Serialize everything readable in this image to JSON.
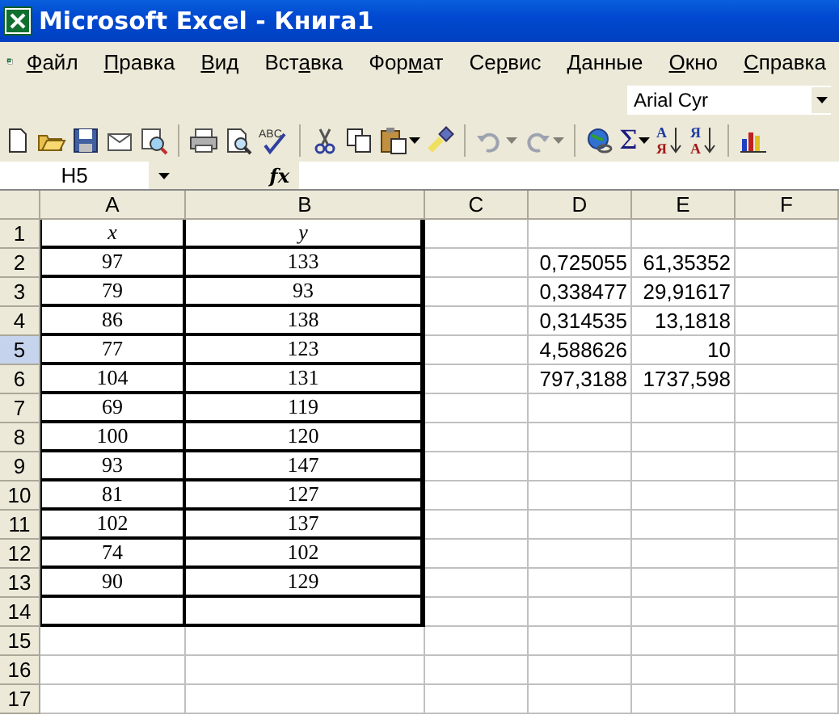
{
  "window": {
    "title": "Microsoft Excel - Книга1"
  },
  "menu": [
    {
      "key": "Ф",
      "post": "айл"
    },
    {
      "key": "П",
      "post": "равка"
    },
    {
      "key": "В",
      "post": "ид"
    },
    {
      "pre": "Вст",
      "key": "а",
      "post": "вка"
    },
    {
      "pre": "Фор",
      "key": "м",
      "post": "ат"
    },
    {
      "pre": "Се",
      "key": "р",
      "post": "вис"
    },
    {
      "key": "Д",
      "post": "анные"
    },
    {
      "key": "О",
      "post": "кно"
    },
    {
      "key": "С",
      "post": "правка"
    }
  ],
  "font_box": {
    "value": "Arial Cyr"
  },
  "toolbar": [
    {
      "kind": "new"
    },
    {
      "kind": "open"
    },
    {
      "kind": "save"
    },
    {
      "kind": "mail"
    },
    {
      "kind": "research"
    },
    {
      "kind": "separator"
    },
    {
      "kind": "print"
    },
    {
      "kind": "preview"
    },
    {
      "kind": "spelling",
      "glyph": "ABC"
    },
    {
      "kind": "separator"
    },
    {
      "kind": "cut"
    },
    {
      "kind": "copy"
    },
    {
      "kind": "paste",
      "dropdown": true
    },
    {
      "kind": "painter"
    },
    {
      "kind": "separator"
    },
    {
      "kind": "undo",
      "disabled": true,
      "dropdown": true
    },
    {
      "kind": "redo",
      "disabled": true,
      "dropdown": true
    },
    {
      "kind": "separator"
    },
    {
      "kind": "link"
    },
    {
      "kind": "sum",
      "glyph": "Σ",
      "dropdown": true
    },
    {
      "kind": "sort",
      "glyph": "А",
      "glyph2": "Я"
    },
    {
      "kind": "sort",
      "glyph": "Я",
      "glyph2": "А"
    },
    {
      "kind": "separator"
    },
    {
      "kind": "chart"
    }
  ],
  "name_box": {
    "value": "H5"
  },
  "formula_bar": {
    "label": "fx"
  },
  "grid": {
    "columns": [
      "A",
      "B",
      "C",
      "D",
      "E",
      "F"
    ],
    "rows": [
      {
        "number": "1",
        "selected": false,
        "boxed": true,
        "cells": {
          "A": "x",
          "B": "y"
        }
      },
      {
        "number": "2",
        "selected": false,
        "boxed": true,
        "cells": {
          "A": "97",
          "B": "133",
          "D": "0,725055",
          "E": "61,35352"
        }
      },
      {
        "number": "3",
        "selected": false,
        "boxed": true,
        "cells": {
          "A": "79",
          "B": "93",
          "D": "0,338477",
          "E": "29,91617"
        }
      },
      {
        "number": "4",
        "selected": false,
        "boxed": true,
        "cells": {
          "A": "86",
          "B": "138",
          "D": "0,314535",
          "E": "13,1818"
        }
      },
      {
        "number": "5",
        "selected": true,
        "boxed": true,
        "cells": {
          "A": "77",
          "B": "123",
          "D": "4,588626",
          "E": "10"
        }
      },
      {
        "number": "6",
        "selected": false,
        "boxed": true,
        "cells": {
          "A": "104",
          "B": "131",
          "D": "797,3188",
          "E": "1737,598"
        }
      },
      {
        "number": "7",
        "selected": false,
        "boxed": true,
        "cells": {
          "A": "69",
          "B": "119"
        }
      },
      {
        "number": "8",
        "selected": false,
        "boxed": true,
        "cells": {
          "A": "100",
          "B": "120"
        }
      },
      {
        "number": "9",
        "selected": false,
        "boxed": true,
        "cells": {
          "A": "93",
          "B": "147"
        }
      },
      {
        "number": "10",
        "selected": false,
        "boxed": true,
        "cells": {
          "A": "81",
          "B": "127"
        }
      },
      {
        "number": "11",
        "selected": false,
        "boxed": true,
        "cells": {
          "A": "102",
          "B": "137"
        }
      },
      {
        "number": "12",
        "selected": false,
        "boxed": true,
        "cells": {
          "A": "74",
          "B": "102"
        }
      },
      {
        "number": "13",
        "selected": false,
        "boxed": true,
        "cells": {
          "A": "90",
          "B": "129"
        }
      },
      {
        "number": "14",
        "selected": false,
        "boxed": true,
        "cells": {}
      },
      {
        "number": "15",
        "selected": false,
        "boxed": false,
        "cells": {}
      },
      {
        "number": "16",
        "selected": false,
        "boxed": false,
        "cells": {}
      },
      {
        "number": "17",
        "selected": false,
        "boxed": false,
        "cells": {}
      }
    ]
  }
}
